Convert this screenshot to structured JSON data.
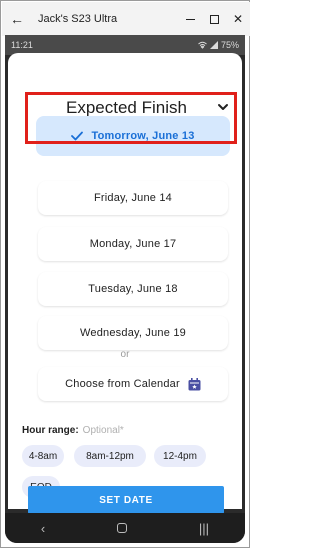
{
  "window": {
    "title": "Jack's S23 Ultra",
    "back_icon": "arrow-left-icon",
    "minimize_icon": "minimize-icon",
    "maximize_icon": "maximize-icon",
    "close_label": "✕"
  },
  "statusbar": {
    "time": "11:21",
    "battery": "75%"
  },
  "sheet": {
    "title": "Expected Finish",
    "chevron_icon": "chevron-down-icon"
  },
  "options": [
    {
      "label": "Tomorrow, June 13",
      "selected": true
    },
    {
      "label": "Friday, June 14",
      "selected": false
    },
    {
      "label": "Monday, June 17",
      "selected": false
    },
    {
      "label": "Tuesday, June 18",
      "selected": false
    },
    {
      "label": "Wednesday, June 19",
      "selected": false
    }
  ],
  "or_label": "or",
  "calendar_button": {
    "label": "Choose from Calendar",
    "icon": "calendar-icon"
  },
  "hour_range": {
    "label": "Hour range:",
    "optional": "Optional*",
    "chips": [
      "4-8am",
      "8am-12pm",
      "12-4pm",
      "EOD"
    ]
  },
  "set_date_label": "SET DATE",
  "navbar": {
    "recents_icon": "recents-icon",
    "home_icon": "home-icon",
    "back_icon": "nav-back-icon"
  },
  "colors": {
    "accent": "#2f95ec",
    "selected_bg": "#d6e8fd",
    "selected_text": "#1a6fd6",
    "highlight_outline": "#e0201a",
    "chip_bg": "#e9ecfa"
  }
}
